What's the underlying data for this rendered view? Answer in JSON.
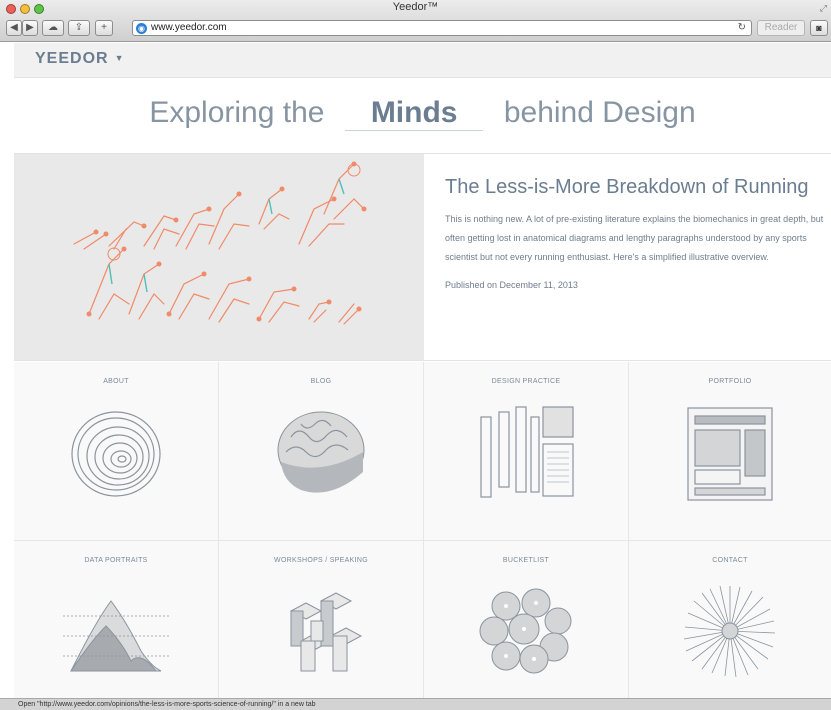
{
  "window": {
    "title": "Yeedor™"
  },
  "toolbar": {
    "back": "◀",
    "forward": "▶",
    "cloud": "☁",
    "share": "⇪",
    "add": "+",
    "url": "www.yeedor.com",
    "reader_label": "Reader",
    "reload": "↻"
  },
  "site": {
    "logo": "YEEDOR",
    "logo_caret": "▼"
  },
  "hero": {
    "prefix": "Exploring the",
    "highlight": "Minds",
    "suffix": "behind Design"
  },
  "feature": {
    "title": "The Less-is-More Breakdown of Running",
    "body": "This is nothing new. A lot of pre-existing literature explains the biomechanics in great depth, but often getting lost in anatomical diagrams and lengthy paragraphs understood by any sports scientist but not every running enthusiast. Here's a simplified illustrative overview.",
    "date": "Published on December 11, 2013"
  },
  "grid": {
    "about": "ABOUT",
    "blog": "BLOG",
    "design_practice": "DESIGN PRACTICE",
    "portfolio": "PORTFOLIO",
    "data_portraits": "DATA PORTRAITS",
    "workshops": "WORKSHOPS / SPEAKING",
    "bucketlist": "BUCKETLIST",
    "contact": "CONTACT"
  },
  "status": {
    "text": "Open \"http://www.yeedor.com/opinions/the-less-is-more-sports-science-of-running/\" in a new tab"
  },
  "colors": {
    "accent": "#6b7d90",
    "runner_orange": "#f08a68",
    "runner_teal": "#4fc1b4"
  }
}
